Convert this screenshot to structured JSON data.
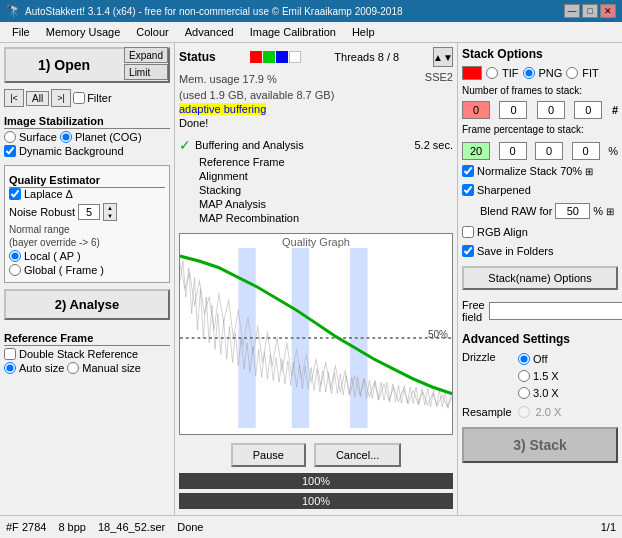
{
  "window": {
    "title": "AutoStakkert! 3.1.4 (x64) - free for non-commercial use © Emil Kraaikamp 2009-2018",
    "controls": [
      "—",
      "□",
      "✕"
    ]
  },
  "menu": {
    "items": [
      "File",
      "Memory Usage",
      "Colour",
      "Advanced",
      "Image Calibration",
      "Help"
    ]
  },
  "left": {
    "open_btn": "1) Open",
    "expand_label": "Expand",
    "limit_label": "Limit",
    "nav": {
      "prev": "|<",
      "all": "All",
      "next": ">|",
      "filter_label": "Filter"
    },
    "image_stabilization": {
      "title": "Image Stabilization",
      "surface_label": "Surface",
      "planet_label": "Planet (COG)",
      "dynamic_bg_label": "Dynamic Background"
    },
    "quality_estimator": {
      "title": "Quality Estimator",
      "laplace_label": "Laplace Δ",
      "noise_robust_label": "Noise Robust",
      "noise_robust_value": "5",
      "normal_range_label": "Normal range",
      "bayer_note": "(bayer override -> 6)",
      "local_label": "Local",
      "ap_label": "( AP )",
      "global_label": "Global",
      "frame_label": "( Frame )"
    },
    "analyse_btn": "2) Analyse",
    "reference_frame": {
      "title": "Reference Frame",
      "double_stack_label": "Double Stack Reference",
      "auto_size_label": "Auto size",
      "manual_size_label": "Manual size"
    }
  },
  "middle": {
    "status_label": "Status",
    "threads_label": "Threads 8 / 8",
    "sse_label": "SSE2",
    "mem_usage": "Mem. usage 17.9 %",
    "mem_detail": "(used 1.9 GB, available 8.7 GB)",
    "adaptive_text": "adaptive buffering",
    "done_text": "Done!",
    "analysis": {
      "check_icon": "✓",
      "items": [
        {
          "label": "Buffering and Analysis",
          "value": "5.2 sec."
        },
        {
          "label": "Reference Frame",
          "value": ""
        },
        {
          "label": "Alignment",
          "value": ""
        },
        {
          "label": "Stacking",
          "value": ""
        },
        {
          "label": "MAP Analysis",
          "value": ""
        },
        {
          "label": "MAP Recombination",
          "value": ""
        }
      ]
    },
    "graph_title": "Quality Graph",
    "graph_percent": "50%",
    "progress1": "100%",
    "progress2": "100%",
    "pause_btn": "Pause",
    "cancel_btn": "Cancel..."
  },
  "right": {
    "stack_options_title": "Stack Options",
    "color_swatch": "#ff0000",
    "format": {
      "tif_label": "TIF",
      "png_label": "PNG",
      "fit_label": "FIT"
    },
    "frames_label": "Number of frames to stack:",
    "frames_values": [
      "0",
      "0",
      "0",
      "0"
    ],
    "frames_hash": "#",
    "pct_label": "Frame percentage to stack:",
    "pct_values": [
      "20",
      "0",
      "0",
      "0"
    ],
    "pct_symbol": "%",
    "normalize_label": "Normalize Stack 70%",
    "normalize_icon": "⊞",
    "sharpened_label": "Sharpened",
    "blend_label": "Blend RAW for",
    "blend_value": "50",
    "blend_unit": "%",
    "blend_icon": "⊞",
    "rgb_align_label": "RGB Align",
    "save_folders_label": "Save in Folders",
    "stack_name_btn": "Stack(name) Options",
    "free_field_label": "Free field",
    "adv_settings_title": "Advanced Settings",
    "drizzle_label": "Drizzle",
    "drizzle_options": [
      "Off",
      "1.5 X",
      "3.0 X"
    ],
    "resample_label": "Resample",
    "resample_option": "2.0 X",
    "stack_btn": "3) Stack"
  },
  "status_bar": {
    "frame_info": "#F 2784",
    "bpp": "8 bpp",
    "file": "18_46_52.ser",
    "status": "Done",
    "page": "1/1"
  }
}
